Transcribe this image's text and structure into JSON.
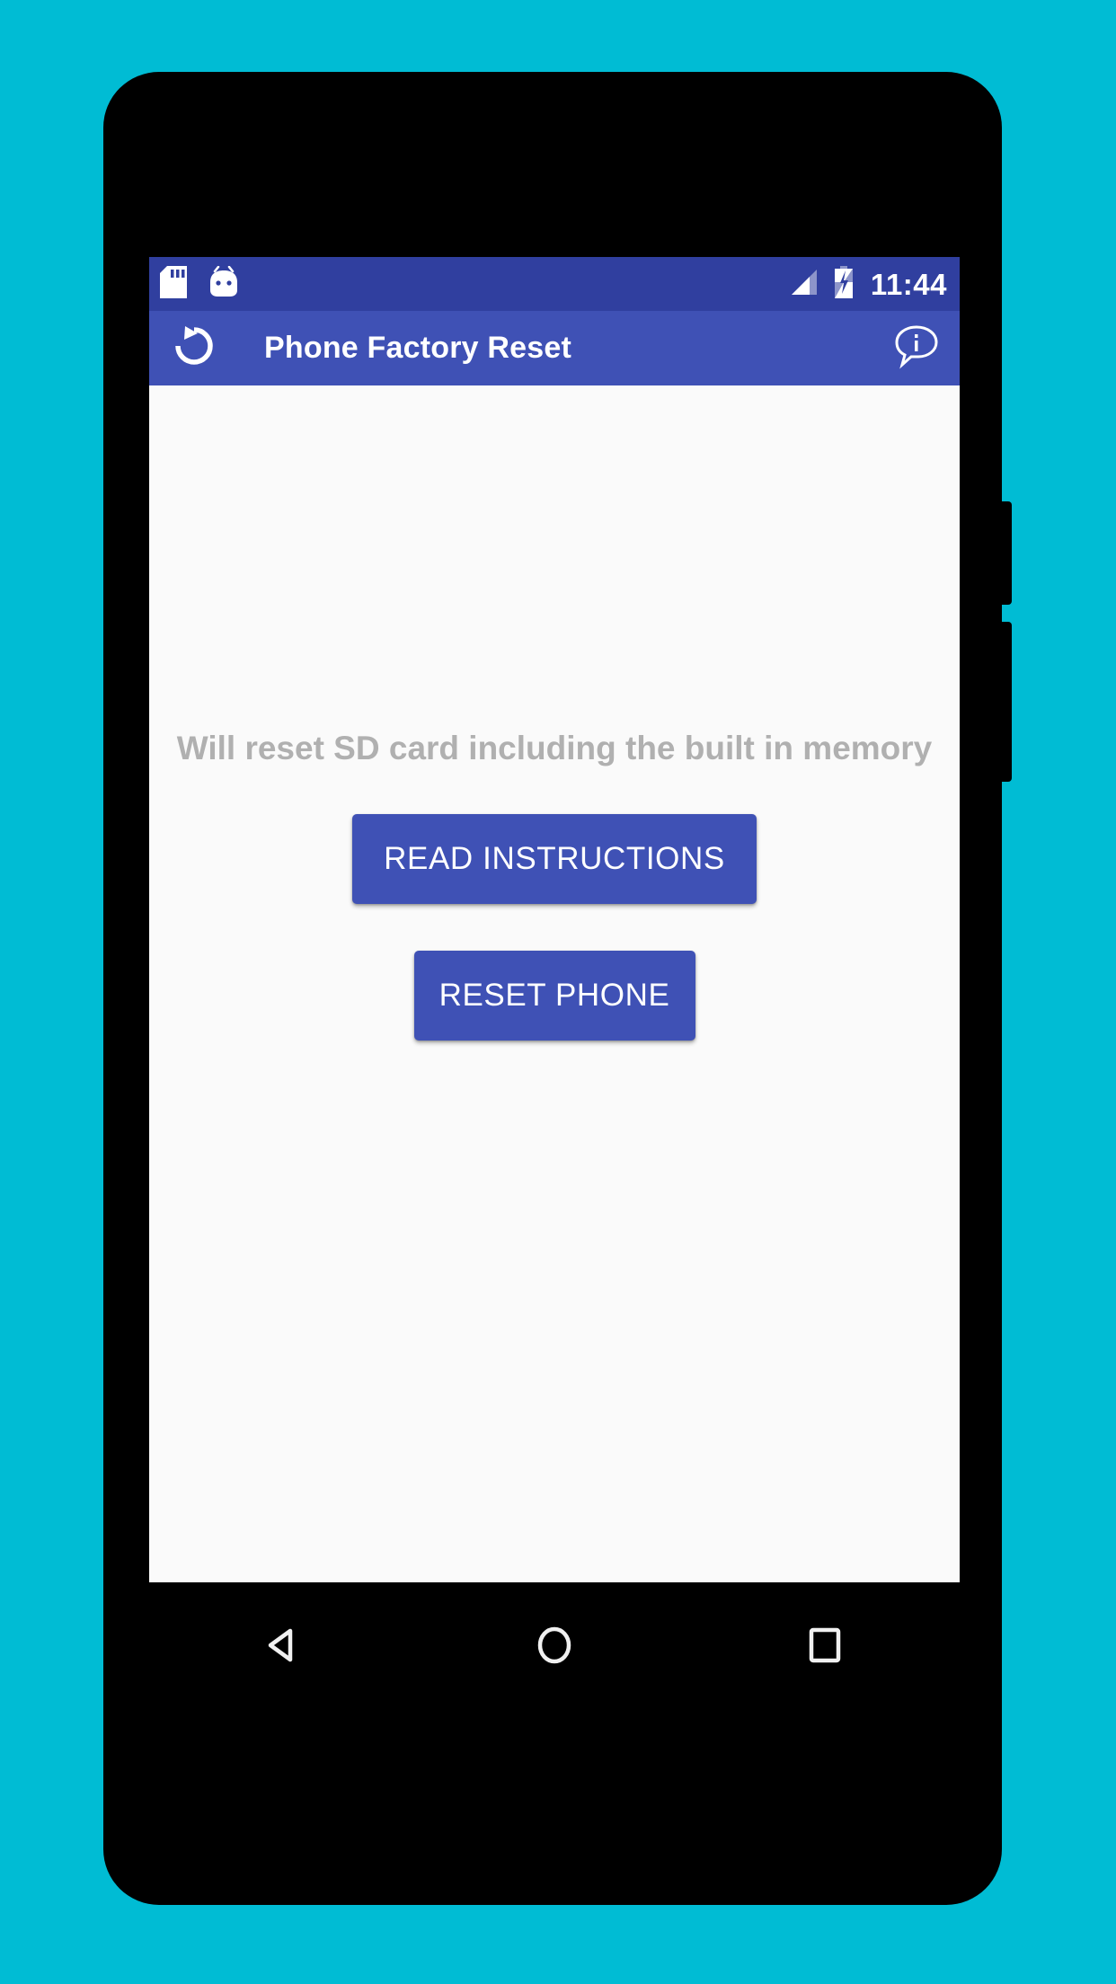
{
  "meta": {
    "background_color": "#00bcd4",
    "device_frame_color": "#000000"
  },
  "status_bar": {
    "background_color": "#303f9f",
    "clock": "11:44",
    "left_icons": [
      {
        "name": "sd-card-icon",
        "label": "SD card"
      },
      {
        "name": "android-mascot-icon",
        "label": "Android system"
      }
    ],
    "right_icons": [
      {
        "name": "cellular-signal-icon",
        "label": "Cellular signal"
      },
      {
        "name": "battery-charging-icon",
        "label": "Battery charging"
      }
    ]
  },
  "app_bar": {
    "background_color": "#3f51b5",
    "title": "Phone Factory Reset",
    "left_icon": {
      "name": "rotate-reset-icon",
      "label": "Reset"
    },
    "right_icon": {
      "name": "info-bubble-icon",
      "label": "Info"
    }
  },
  "content": {
    "background_color": "#fafafa",
    "hint_text": "Will reset SD card including the built in memory",
    "hint_color": "#b0b0b0",
    "buttons": [
      {
        "name": "read-instructions-button",
        "label": "READ INSTRUCTIONS",
        "color": "#3f51b5"
      },
      {
        "name": "reset-phone-button",
        "label": "RESET PHONE",
        "color": "#3f51b5"
      }
    ]
  },
  "nav_bar": {
    "background_color": "#000000",
    "buttons": [
      {
        "name": "nav-back-button",
        "icon": "back-triangle-icon",
        "label": "Back"
      },
      {
        "name": "nav-home-button",
        "icon": "home-circle-icon",
        "label": "Home"
      },
      {
        "name": "nav-recents-button",
        "icon": "recents-square-icon",
        "label": "Recents"
      }
    ]
  },
  "hardware": {
    "power_button_label": "Power",
    "volume_button_label": "Volume"
  }
}
